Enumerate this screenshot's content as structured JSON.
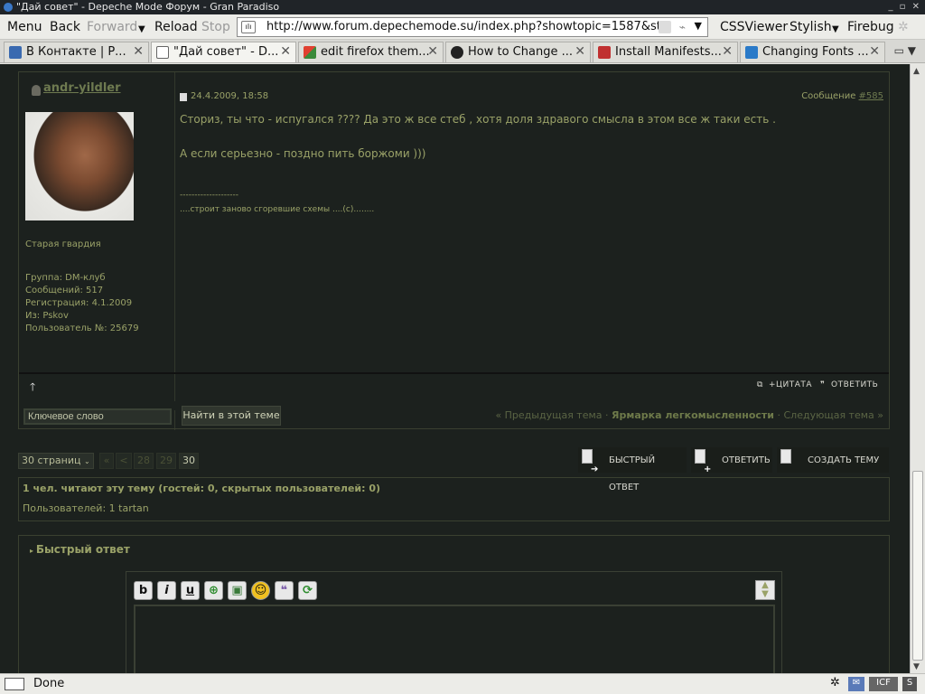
{
  "window": {
    "title": "\"Дай совет\" - Depeche Mode Форум - Gran Paradiso",
    "buttons": "_ ▫ ✕"
  },
  "toolbar": {
    "menu": "Menu",
    "back": "Back",
    "forward": "Forward",
    "reload": "Reload",
    "stop": "Stop",
    "url": "http://www.forum.depechemode.su/index.php?showtopic=1587&st=",
    "cssviewer": "CSSViewer",
    "stylish": "Stylish",
    "firebug": "Firebug"
  },
  "tabs": [
    {
      "label": "В Контакте | Р...",
      "color": "#3a6ab0"
    },
    {
      "label": "\"Дай совет\" - D...",
      "color": "#ffffff"
    },
    {
      "label": "edit firefox them...",
      "color": "#e04030"
    },
    {
      "label": "How to Change ...",
      "color": "#222222"
    },
    {
      "label": "Install Manifests...",
      "color": "#c03030"
    },
    {
      "label": "Changing Fonts ...",
      "color": "#2a7ac8"
    }
  ],
  "post": {
    "author": "andr-yildler",
    "date": "24.4.2009, 18:58",
    "message_label": "Сообщение ",
    "message_num": "#585",
    "rank": "Старая гвардия",
    "group": "Группа: DM-клуб",
    "posts": "Сообщений: 517",
    "registered": "Регистрация: 4.1.2009",
    "from": "Из: Pskov",
    "user_no": "Пользователь №: 25679",
    "text1": "Сториз, ты что - испугался ???? Да это ж все стеб , хотя доля здравого смысла в этом все ж таки есть .",
    "text2": "А если серьезно - поздно пить боржоми )))",
    "sig_line": "--------------------",
    "sig": "....строит заново сгоревшие схемы ....(с)........",
    "quote_btn": "+ЦИТАТА",
    "reply_btn": "ОТВЕТИТЬ"
  },
  "search": {
    "placeholder": "Ключевое слово",
    "button": "Найти в этой теме",
    "prev": "« Предыдущая тема · ",
    "topic": "Ярмарка легкомысленности",
    "next": " · Следующая тема »"
  },
  "pager": {
    "select": "30 страниц",
    "first": "«",
    "prev": "<",
    "pages": [
      "28",
      "29",
      "30"
    ]
  },
  "actions": {
    "quick_reply": "БЫСТРЫЙ ОТВЕТ",
    "reply": "ОТВЕТИТЬ",
    "new_topic": "СОЗДАТЬ ТЕМУ"
  },
  "readers": {
    "line1": "1 чел. читают эту тему (гостей: 0, скрытых пользователей: 0)",
    "line2_label": "Пользователей: ",
    "line2_users": "1 tartan"
  },
  "quick_reply": {
    "title": "Быстрый ответ",
    "tools": [
      "b",
      "i",
      "u"
    ]
  },
  "status": {
    "text": "Done",
    "icf": "ICF"
  }
}
